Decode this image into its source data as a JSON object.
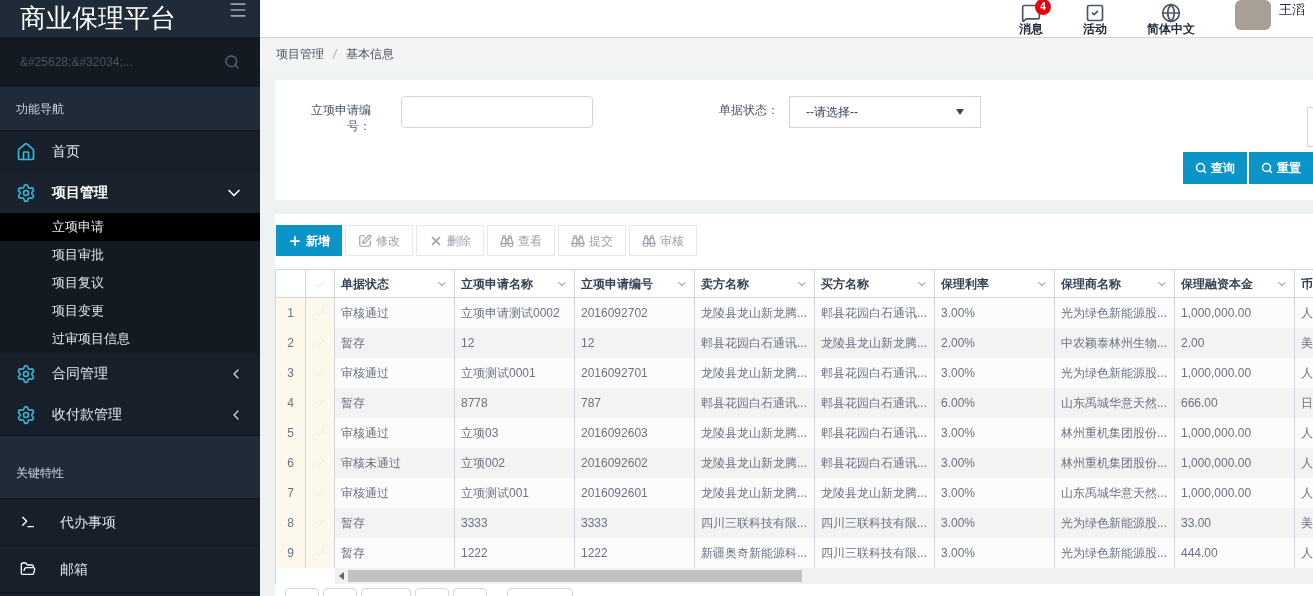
{
  "app_title": "商业保理平台",
  "sidebar": {
    "search_placeholder": "&#25628;&#32034;...",
    "nav_heading": "功能导航",
    "items": [
      {
        "label": "首页",
        "kind": "home",
        "expanded": false
      },
      {
        "label": "项目管理",
        "kind": "gear",
        "expanded": true,
        "children": [
          {
            "label": "立项申请",
            "selected": true
          },
          {
            "label": "项目审批",
            "selected": false
          },
          {
            "label": "项目复议",
            "selected": false
          },
          {
            "label": "项目变更",
            "selected": false
          },
          {
            "label": "过审项目信息",
            "selected": false
          }
        ]
      },
      {
        "label": "合同管理",
        "kind": "gear",
        "expanded": false
      },
      {
        "label": "收付款管理",
        "kind": "gear",
        "expanded": false
      }
    ],
    "features_heading": "关键特性",
    "features": [
      {
        "label": "代办事项",
        "kind": "terminal"
      },
      {
        "label": "邮箱",
        "kind": "folder"
      }
    ]
  },
  "header": {
    "actions": [
      {
        "label": "消息",
        "kind": "message",
        "badge": "4"
      },
      {
        "label": "活动",
        "kind": "task"
      },
      {
        "label": "简体中文",
        "kind": "globe"
      }
    ],
    "user_name": "王滔"
  },
  "breadcrumb": [
    "项目管理",
    "基本信息"
  ],
  "filters": {
    "fields": [
      {
        "label": "立项申请编号：",
        "kind": "text"
      },
      {
        "label": "单据状态：",
        "kind": "select",
        "value": "--请选择--"
      }
    ],
    "buttons": [
      "查询",
      "重置"
    ]
  },
  "toolbar": [
    {
      "label": "新增",
      "kind": "plus",
      "primary": true
    },
    {
      "label": "修改",
      "kind": "edit",
      "primary": false
    },
    {
      "label": "删除",
      "kind": "delete",
      "primary": false
    },
    {
      "label": "查看",
      "kind": "view",
      "primary": false
    },
    {
      "label": "提交",
      "kind": "view",
      "primary": false
    },
    {
      "label": "审核",
      "kind": "view",
      "primary": false
    }
  ],
  "table": {
    "columns": [
      "单据状态",
      "立项申请名称",
      "立项申请编号",
      "卖方名称",
      "买方名称",
      "保理利率",
      "保理商名称",
      "保理融资本金",
      "币"
    ],
    "rows": [
      {
        "index": "1",
        "checked": false,
        "cells": [
          "审核通过",
          "立项申请测试0002",
          "2016092702",
          "龙陵县龙山新龙腾...",
          "郫县花园白石通讯...",
          "3.00%",
          "光为绿色新能源股...",
          "1,000,000.00",
          "人"
        ]
      },
      {
        "index": "2",
        "checked": false,
        "cells": [
          "暂存",
          "12",
          "12",
          "郫县花园白石通讯...",
          "龙陵县龙山新龙腾...",
          "2.00%",
          "中农颖泰林州生物...",
          "2.00",
          "美"
        ]
      },
      {
        "index": "3",
        "checked": false,
        "cells": [
          "审核通过",
          "立项测试0001",
          "2016092701",
          "龙陵县龙山新龙腾...",
          "郫县花园白石通讯...",
          "3.00%",
          "光为绿色新能源股...",
          "1,000,000.00",
          "人"
        ]
      },
      {
        "index": "4",
        "checked": false,
        "cells": [
          "暂存",
          "8778",
          "787",
          "郫县花园白石通讯...",
          "郫县花园白石通讯...",
          "6.00%",
          "山东禹城华意天然...",
          "666.00",
          "日"
        ]
      },
      {
        "index": "5",
        "checked": false,
        "cells": [
          "审核通过",
          "立项03",
          "2016092603",
          "龙陵县龙山新龙腾...",
          "郫县花园白石通讯...",
          "3.00%",
          "林州重机集团股份...",
          "1,000,000.00",
          "人"
        ]
      },
      {
        "index": "6",
        "checked": false,
        "cells": [
          "审核未通过",
          "立项002",
          "2016092602",
          "龙陵县龙山新龙腾...",
          "郫县花园白石通讯...",
          "3.00%",
          "林州重机集团股份...",
          "1,000,000.00",
          "人"
        ]
      },
      {
        "index": "7",
        "checked": false,
        "cells": [
          "审核通过",
          "立项测试001",
          "2016092601",
          "龙陵县龙山新龙腾...",
          "龙陵县龙山新龙腾...",
          "3.00%",
          "山东禹城华意天然...",
          "1,000,000.00",
          "人"
        ]
      },
      {
        "index": "8",
        "checked": false,
        "cells": [
          "暂存",
          "3333",
          "3333",
          "四川三联科技有限...",
          "四川三联科技有限...",
          "3.00%",
          "光为绿色新能源股...",
          "33.00",
          "美"
        ]
      },
      {
        "index": "9",
        "checked": false,
        "cells": [
          "暂存",
          "1222",
          "1222",
          "新疆奥奇新能源科...",
          "四川三联科技有限...",
          "3.00%",
          "光为绿色新能源股...",
          "444.00",
          "人"
        ]
      }
    ]
  }
}
